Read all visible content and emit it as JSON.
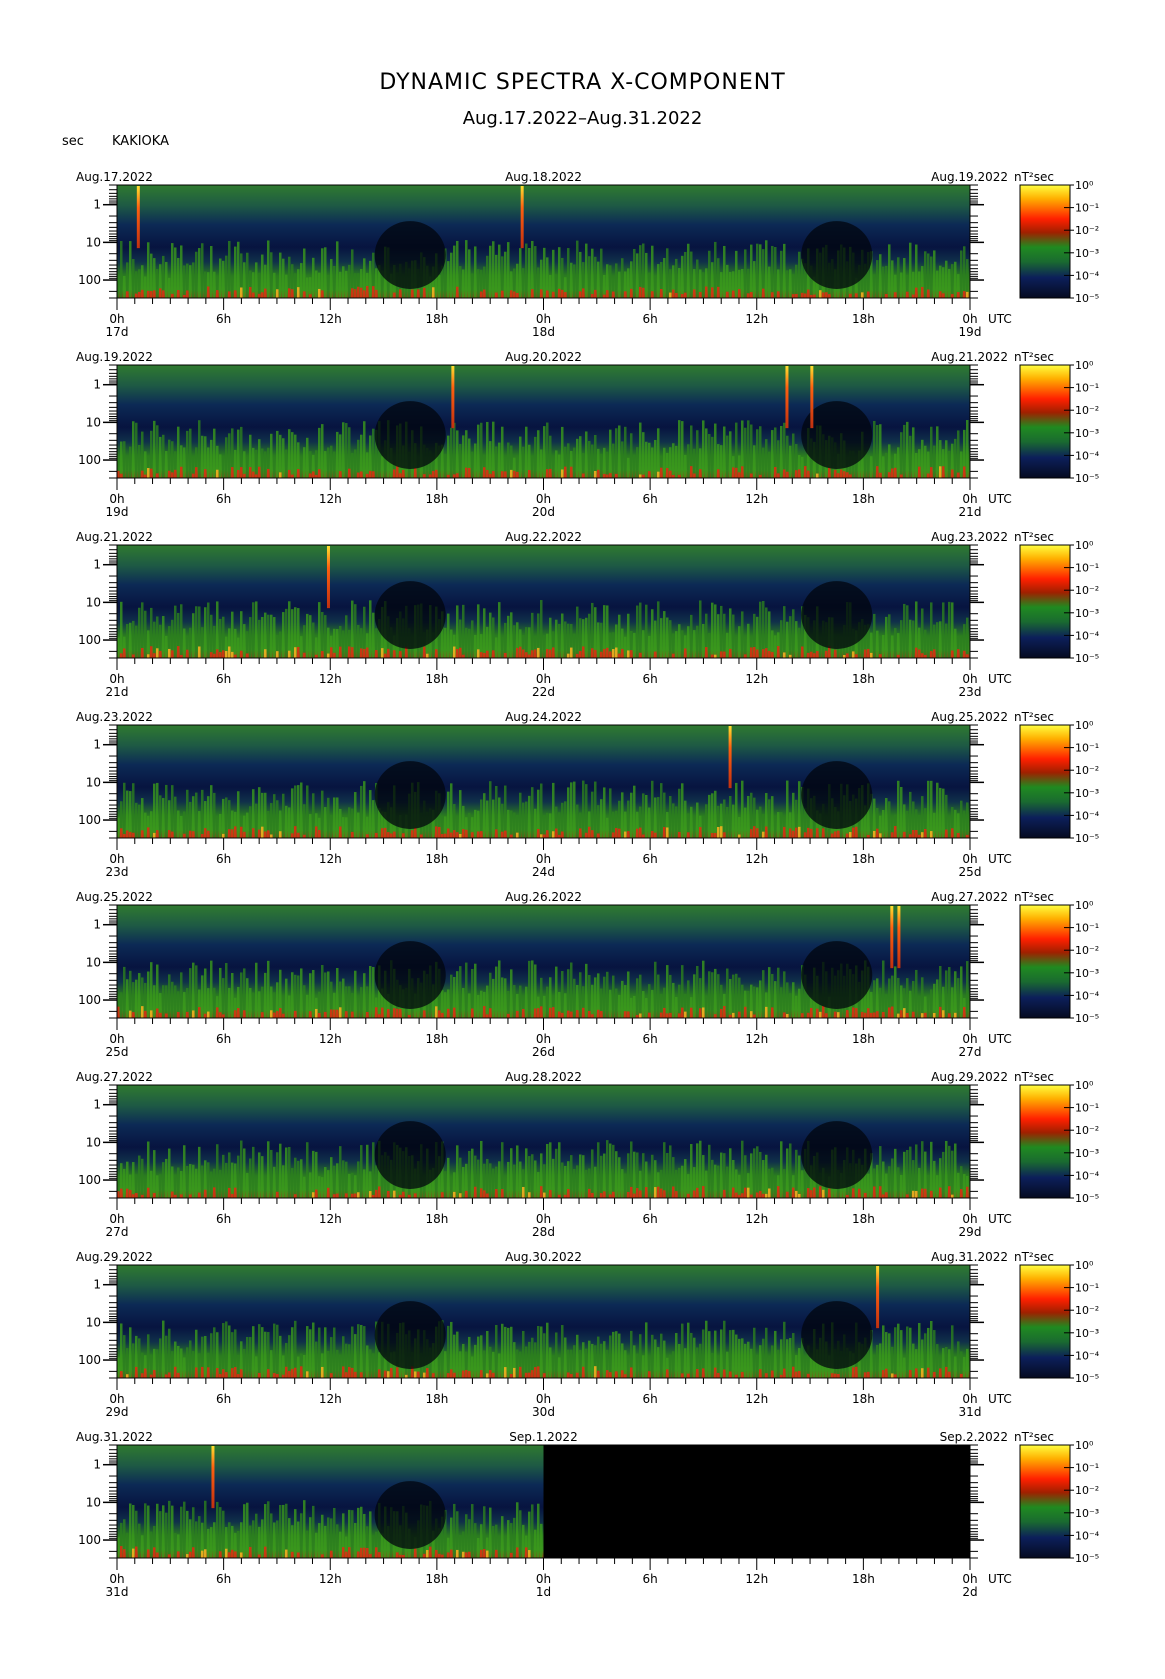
{
  "title": "DYNAMIC SPECTRA X-COMPONENT",
  "subtitle": "Aug.17.2022–Aug.31.2022",
  "station": "KAKIOKA",
  "y_unit": "sec",
  "colorbar_unit": "nT²sec",
  "x_unit": "UTC",
  "chart_data": [
    {
      "type": "heatmap",
      "panel": 1,
      "start_label": "Aug.17.2022",
      "mid_label": "Aug.18.2022",
      "end_label": "Aug.19.2022",
      "x_ticks": [
        "0h",
        "6h",
        "12h",
        "18h",
        "0h",
        "6h",
        "12h",
        "18h",
        "0h"
      ],
      "day_labels": [
        "17d",
        "18d",
        "19d"
      ],
      "y_ticks": [
        "1",
        "10",
        "100"
      ],
      "y_scale": "log",
      "y_range_sec": [
        0.3,
        300
      ],
      "colorbar_ticks": [
        "10⁰",
        "10⁻¹",
        "10⁻²",
        "10⁻³",
        "10⁻⁴",
        "10⁻⁵"
      ],
      "colorbar_range": [
        1e-05,
        1
      ],
      "no_data_from_h": null,
      "events_h": [
        1.2,
        22.8
      ]
    },
    {
      "type": "heatmap",
      "panel": 2,
      "start_label": "Aug.19.2022",
      "mid_label": "Aug.20.2022",
      "end_label": "Aug.21.2022",
      "x_ticks": [
        "0h",
        "6h",
        "12h",
        "18h",
        "0h",
        "6h",
        "12h",
        "18h",
        "0h"
      ],
      "day_labels": [
        "19d",
        "20d",
        "21d"
      ],
      "y_ticks": [
        "1",
        "10",
        "100"
      ],
      "y_scale": "log",
      "y_range_sec": [
        0.3,
        300
      ],
      "colorbar_ticks": [
        "10⁰",
        "10⁻¹",
        "10⁻²",
        "10⁻³",
        "10⁻⁴",
        "10⁻⁵"
      ],
      "colorbar_range": [
        1e-05,
        1
      ],
      "no_data_from_h": null,
      "events_h": [
        18.9,
        37.7,
        39.1
      ]
    },
    {
      "type": "heatmap",
      "panel": 3,
      "start_label": "Aug.21.2022",
      "mid_label": "Aug.22.2022",
      "end_label": "Aug.23.2022",
      "x_ticks": [
        "0h",
        "6h",
        "12h",
        "18h",
        "0h",
        "6h",
        "12h",
        "18h",
        "0h"
      ],
      "day_labels": [
        "21d",
        "22d",
        "23d"
      ],
      "y_ticks": [
        "1",
        "10",
        "100"
      ],
      "y_scale": "log",
      "y_range_sec": [
        0.3,
        300
      ],
      "colorbar_ticks": [
        "10⁰",
        "10⁻¹",
        "10⁻²",
        "10⁻³",
        "10⁻⁴",
        "10⁻⁵"
      ],
      "colorbar_range": [
        1e-05,
        1
      ],
      "no_data_from_h": null,
      "events_h": [
        11.9
      ]
    },
    {
      "type": "heatmap",
      "panel": 4,
      "start_label": "Aug.23.2022",
      "mid_label": "Aug.24.2022",
      "end_label": "Aug.25.2022",
      "x_ticks": [
        "0h",
        "6h",
        "12h",
        "18h",
        "0h",
        "6h",
        "12h",
        "18h",
        "0h"
      ],
      "day_labels": [
        "23d",
        "24d",
        "25d"
      ],
      "y_ticks": [
        "1",
        "10",
        "100"
      ],
      "y_scale": "log",
      "y_range_sec": [
        0.3,
        300
      ],
      "colorbar_ticks": [
        "10⁰",
        "10⁻¹",
        "10⁻²",
        "10⁻³",
        "10⁻⁴",
        "10⁻⁵"
      ],
      "colorbar_range": [
        1e-05,
        1
      ],
      "no_data_from_h": null,
      "events_h": [
        34.5
      ]
    },
    {
      "type": "heatmap",
      "panel": 5,
      "start_label": "Aug.25.2022",
      "mid_label": "Aug.26.2022",
      "end_label": "Aug.27.2022",
      "x_ticks": [
        "0h",
        "6h",
        "12h",
        "18h",
        "0h",
        "6h",
        "12h",
        "18h",
        "0h"
      ],
      "day_labels": [
        "25d",
        "26d",
        "27d"
      ],
      "y_ticks": [
        "1",
        "10",
        "100"
      ],
      "y_scale": "log",
      "y_range_sec": [
        0.3,
        300
      ],
      "colorbar_ticks": [
        "10⁰",
        "10⁻¹",
        "10⁻²",
        "10⁻³",
        "10⁻⁴",
        "10⁻⁵"
      ],
      "colorbar_range": [
        1e-05,
        1
      ],
      "no_data_from_h": null,
      "events_h": [
        43.6,
        44.0
      ]
    },
    {
      "type": "heatmap",
      "panel": 6,
      "start_label": "Aug.27.2022",
      "mid_label": "Aug.28.2022",
      "end_label": "Aug.29.2022",
      "x_ticks": [
        "0h",
        "6h",
        "12h",
        "18h",
        "0h",
        "6h",
        "12h",
        "18h",
        "0h"
      ],
      "day_labels": [
        "27d",
        "28d",
        "29d"
      ],
      "y_ticks": [
        "1",
        "10",
        "100"
      ],
      "y_scale": "log",
      "y_range_sec": [
        0.3,
        300
      ],
      "colorbar_ticks": [
        "10⁰",
        "10⁻¹",
        "10⁻²",
        "10⁻³",
        "10⁻⁴",
        "10⁻⁵"
      ],
      "colorbar_range": [
        1e-05,
        1
      ],
      "no_data_from_h": null,
      "events_h": []
    },
    {
      "type": "heatmap",
      "panel": 7,
      "start_label": "Aug.29.2022",
      "mid_label": "Aug.30.2022",
      "end_label": "Aug.31.2022",
      "x_ticks": [
        "0h",
        "6h",
        "12h",
        "18h",
        "0h",
        "6h",
        "12h",
        "18h",
        "0h"
      ],
      "day_labels": [
        "29d",
        "30d",
        "31d"
      ],
      "y_ticks": [
        "1",
        "10",
        "100"
      ],
      "y_scale": "log",
      "y_range_sec": [
        0.3,
        300
      ],
      "colorbar_ticks": [
        "10⁰",
        "10⁻¹",
        "10⁻²",
        "10⁻³",
        "10⁻⁴",
        "10⁻⁵"
      ],
      "colorbar_range": [
        1e-05,
        1
      ],
      "no_data_from_h": null,
      "events_h": [
        42.8
      ]
    },
    {
      "type": "heatmap",
      "panel": 8,
      "start_label": "Aug.31.2022",
      "mid_label": "Sep.1.2022",
      "end_label": "Sep.2.2022",
      "x_ticks": [
        "0h",
        "6h",
        "12h",
        "18h",
        "0h",
        "6h",
        "12h",
        "18h",
        "0h"
      ],
      "day_labels": [
        "31d",
        "1d",
        "2d"
      ],
      "y_ticks": [
        "1",
        "10",
        "100"
      ],
      "y_scale": "log",
      "y_range_sec": [
        0.3,
        300
      ],
      "colorbar_ticks": [
        "10⁰",
        "10⁻¹",
        "10⁻²",
        "10⁻³",
        "10⁻⁴",
        "10⁻⁵"
      ],
      "colorbar_range": [
        1e-05,
        1
      ],
      "no_data_from_h": 24,
      "events_h": [
        5.4
      ]
    }
  ]
}
